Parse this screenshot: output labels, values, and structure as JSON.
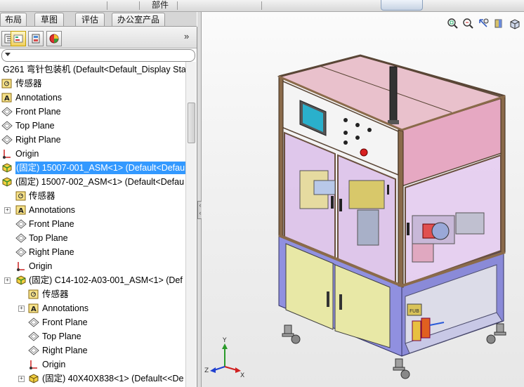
{
  "menubar": {
    "items": [
      "部件"
    ],
    "colors": {
      "accent_pill": "#c7d3e3"
    }
  },
  "command_tabs": [
    {
      "label": "布局"
    },
    {
      "label": "草图"
    },
    {
      "label": "评估"
    },
    {
      "label": "办公室产品"
    }
  ],
  "panel": {
    "toolbar_icons": [
      "feature-manager-icon",
      "property-manager-icon",
      "configuration-manager-icon",
      "display-manager-icon"
    ],
    "chevron": "»"
  },
  "tree": {
    "root": "G261 弯针包装机  (Default<Default_Display Sta",
    "items": [
      {
        "label": "传感器",
        "icon": "sensor-icon"
      },
      {
        "label": "Annotations",
        "icon": "annotations-icon"
      },
      {
        "label": "Front Plane",
        "icon": "plane-icon"
      },
      {
        "label": "Top Plane",
        "icon": "plane-icon"
      },
      {
        "label": "Right Plane",
        "icon": "plane-icon"
      },
      {
        "label": "Origin",
        "icon": "origin-icon"
      },
      {
        "label": "(固定) 15007-001_ASM<1> (Default<Defau",
        "icon": "assembly-icon",
        "selected": true
      },
      {
        "label": "(固定) 15007-002_ASM<1> (Default<Defau",
        "icon": "assembly-icon"
      },
      {
        "label": "传感器",
        "icon": "sensor-icon"
      },
      {
        "label": "Annotations",
        "icon": "annotations-icon"
      },
      {
        "label": "Front Plane",
        "icon": "plane-icon"
      },
      {
        "label": "Top Plane",
        "icon": "plane-icon"
      },
      {
        "label": "Right Plane",
        "icon": "plane-icon"
      },
      {
        "label": "Origin",
        "icon": "origin-icon"
      },
      {
        "label": "(固定) C14-102-A03-001_ASM<1> (Def",
        "icon": "assembly-icon"
      },
      {
        "label": "传感器",
        "icon": "sensor-icon"
      },
      {
        "label": "Annotations",
        "icon": "annotations-icon"
      },
      {
        "label": "Front Plane",
        "icon": "plane-icon"
      },
      {
        "label": "Top Plane",
        "icon": "plane-icon"
      },
      {
        "label": "Right Plane",
        "icon": "plane-icon"
      },
      {
        "label": "Origin",
        "icon": "origin-icon"
      },
      {
        "label": "(固定) 40X40X838<1> (Default<<De",
        "icon": "part-icon"
      }
    ]
  },
  "viewport": {
    "view_icons": [
      "zoom-to-fit-icon",
      "zoom-to-area-icon",
      "previous-view-icon",
      "section-view-icon",
      "view-orientation-icon"
    ],
    "triad": {
      "x": "X",
      "y": "Y",
      "z": "Z"
    },
    "model_colors": {
      "frame": "#8a6a4a",
      "panel_pink": "#e8aac4",
      "base_blue": "#8a8ae6",
      "cabinet_yellow": "#e6e6a0",
      "hmi_screen": "#2aa8c8"
    }
  }
}
